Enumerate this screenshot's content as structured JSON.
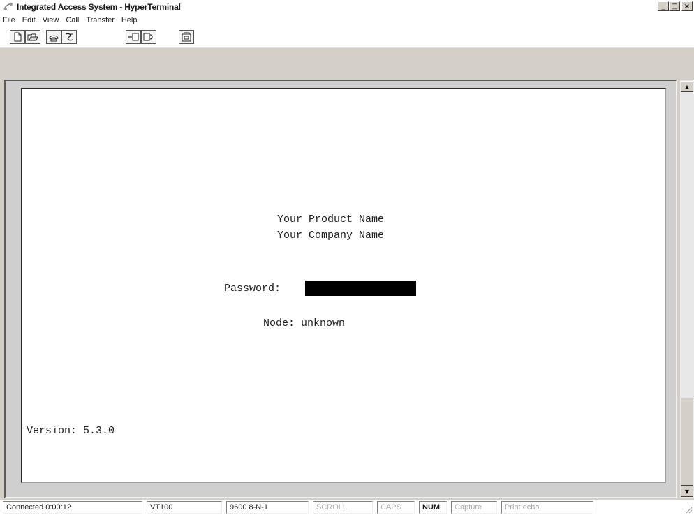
{
  "window": {
    "title": "Integrated Access System - HyperTerminal",
    "controls": {
      "minimize": "_",
      "maximize": "□",
      "close": "×"
    }
  },
  "menu": [
    "File",
    "Edit",
    "View",
    "Call",
    "Transfer",
    "Help"
  ],
  "toolbar": {
    "icons": [
      "new-document-icon",
      "open-folder-icon",
      "connect-phone-icon",
      "disconnect-icon",
      "send-file-icon",
      "receive-file-icon",
      "properties-icon"
    ]
  },
  "terminal": {
    "product_name": "Your Product Name",
    "company_name": "Your Company Name",
    "password_label": "Password:",
    "password_value": "",
    "node_line": "Node: unknown",
    "version_line": "Version: 5.3.0"
  },
  "status": {
    "connected": "Connected 0:00:12",
    "emulation": "VT100",
    "port_settings": "9600 8-N-1",
    "scroll": "SCROLL",
    "caps": "CAPS",
    "num": "NUM",
    "capture": "Capture",
    "print_echo": "Print echo"
  },
  "colors": {
    "window_bg": "#d4d0c8",
    "screen_bg": "#ffffff",
    "password_field": "#000000"
  }
}
